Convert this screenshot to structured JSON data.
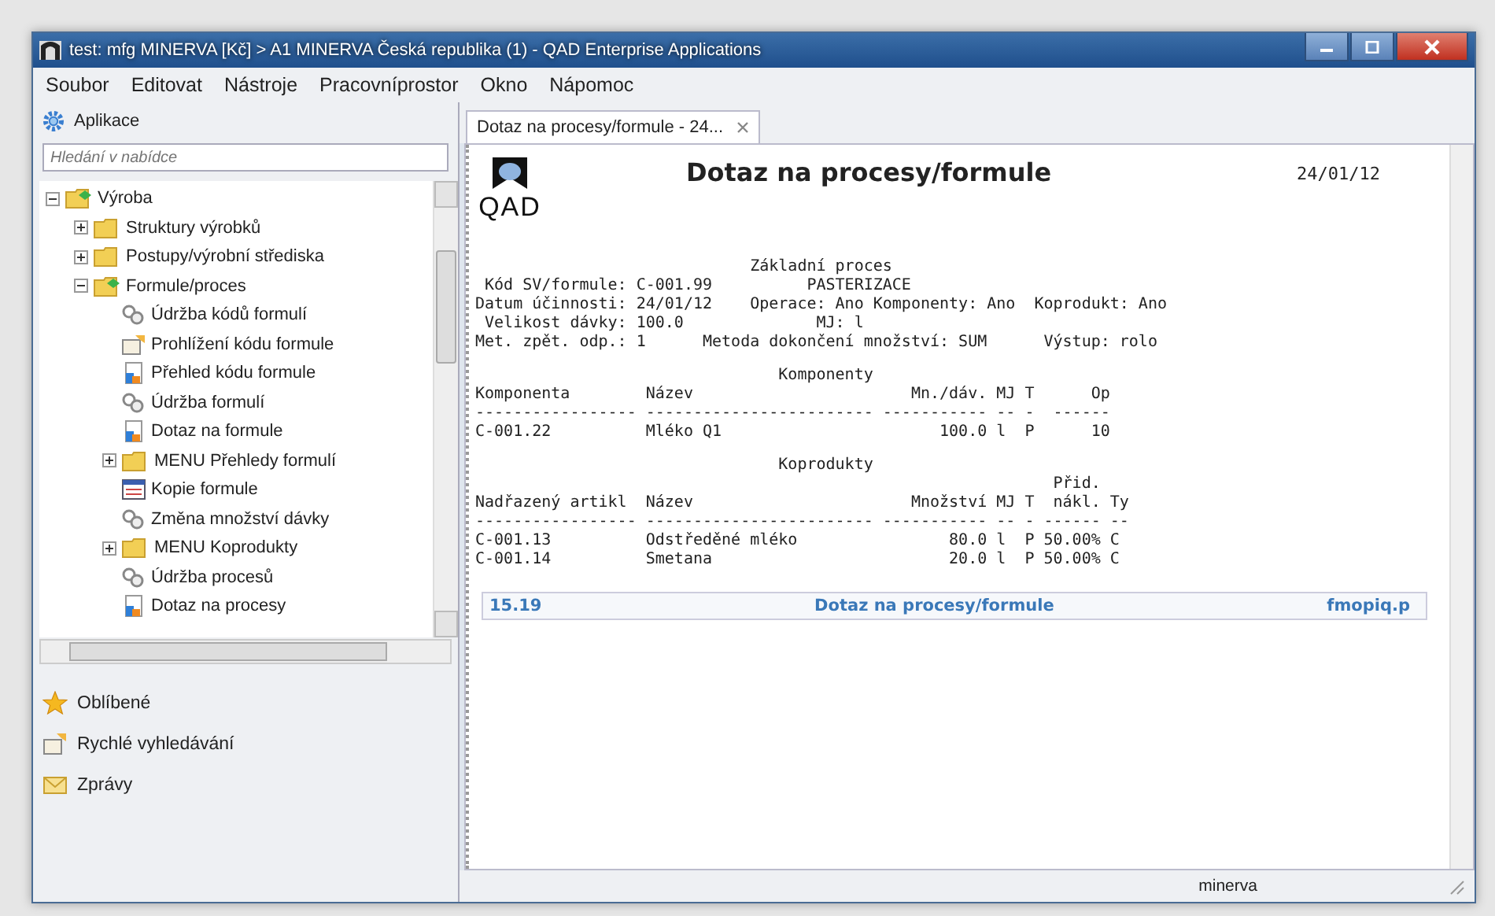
{
  "window": {
    "title": "test: mfg MINERVA [Kč] > A1 MINERVA Česká republika (1) - QAD Enterprise Applications"
  },
  "menu": [
    "Soubor",
    "Editovat",
    "Nástroje",
    "Pracovníprostor",
    "Okno",
    "Nápomoc"
  ],
  "sidebar": {
    "header": "Aplikace",
    "search": {
      "placeholder": "Hledání v nabídce"
    },
    "tree": [
      {
        "label": "Výroba",
        "kind": "folder",
        "expanded": true,
        "children": [
          {
            "label": "Struktury výrobků",
            "kind": "folder",
            "expanded": false
          },
          {
            "label": "Postupy/výrobní střediska",
            "kind": "folder",
            "expanded": false
          },
          {
            "label": "Formule/proces",
            "kind": "folder",
            "expanded": true,
            "children": [
              {
                "label": "Údržba kódů formulí",
                "kind": "maintenance"
              },
              {
                "label": "Prohlížení kódu formule",
                "kind": "browse"
              },
              {
                "label": "Přehled kódu formule",
                "kind": "report"
              },
              {
                "label": "Údržba formulí",
                "kind": "maintenance"
              },
              {
                "label": "Dotaz na formule",
                "kind": "report"
              },
              {
                "label": "MENU Přehledy formulí",
                "kind": "folder",
                "expanded": false
              },
              {
                "label": "Kopie formule",
                "kind": "copy"
              },
              {
                "label": "Změna množství dávky",
                "kind": "maintenance"
              },
              {
                "label": "MENU Koprodukty",
                "kind": "folder",
                "expanded": false
              },
              {
                "label": "Údržba procesů",
                "kind": "maintenance"
              },
              {
                "label": "Dotaz na procesy",
                "kind": "report"
              }
            ]
          }
        ]
      }
    ],
    "sections": [
      {
        "label": "Oblíbené",
        "kind": "star"
      },
      {
        "label": "Rychlé vyhledávání",
        "kind": "browse"
      },
      {
        "label": "Zprávy",
        "kind": "mail"
      }
    ]
  },
  "tabs": [
    {
      "label": "Dotaz na procesy/formule - 24...",
      "selected": true
    }
  ],
  "report": {
    "logo": "QAD",
    "title": "Dotaz na procesy/formule",
    "date": "24/01/12",
    "blocks": [
      [
        "                             Základní proces",
        " Kód SV/formule: C-001.99          PASTERIZACE",
        "Datum účinnosti: 24/01/12    Operace: Ano Komponenty: Ano  Koprodukt: Ano",
        " Velikost dávky: 100.0              MJ: l",
        "Met. zpět. odp.: 1      Metoda dokončení množství: SUM      Výstup: rolo"
      ],
      [
        "                                Komponenty",
        "Komponenta        Název                       Mn./dáv. MJ T      Op",
        "----------------- ------------------------ ----------- -- -  ------",
        "C-001.22          Mléko Q1                       100.0 l  P      10"
      ],
      [
        "                                Koprodukty",
        "                                                             Přid.",
        "Nadřazený artikl  Název                       Množství MJ T  nákl. Ty",
        "----------------- ------------------------ ----------- -- - ------ --",
        "C-001.13          Odstředěné mléko                80.0 l  P 50.00% C",
        "C-001.14          Smetana                         20.0 l  P 50.00% C"
      ]
    ],
    "footer": {
      "code": "15.19",
      "title": "Dotaz na procesy/formule",
      "program": "fmopiq.p"
    }
  },
  "status_bar": {
    "user": "minerva"
  }
}
